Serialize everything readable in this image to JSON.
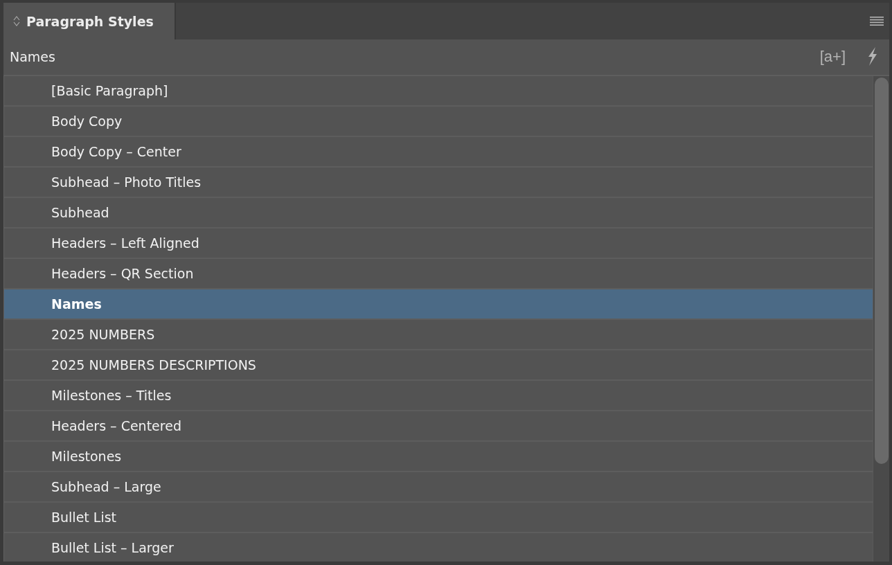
{
  "panel": {
    "tab": {
      "label": "Paragraph Styles",
      "selected": true
    }
  },
  "column_header": {
    "label": "Names"
  },
  "toolbar": {
    "new_style_button": {
      "label": "[a+]"
    }
  },
  "styles": [
    {
      "name": "[Basic Paragraph]",
      "selected": false
    },
    {
      "name": "Body Copy",
      "selected": false
    },
    {
      "name": "Body Copy – Center",
      "selected": false
    },
    {
      "name": "Subhead – Photo Titles",
      "selected": false
    },
    {
      "name": "Subhead",
      "selected": false
    },
    {
      "name": "Headers – Left Aligned",
      "selected": false
    },
    {
      "name": "Headers – QR Section",
      "selected": false
    },
    {
      "name": "Names",
      "selected": true
    },
    {
      "name": "2025 NUMBERS",
      "selected": false
    },
    {
      "name": "2025 NUMBERS DESCRIPTIONS",
      "selected": false
    },
    {
      "name": "Milestones – Titles",
      "selected": false
    },
    {
      "name": "Headers – Centered",
      "selected": false
    },
    {
      "name": "Milestones",
      "selected": false
    },
    {
      "name": "Subhead – Large",
      "selected": false
    },
    {
      "name": "Bullet List",
      "selected": false
    },
    {
      "name": "Bullet List – Larger",
      "selected": false
    }
  ]
}
